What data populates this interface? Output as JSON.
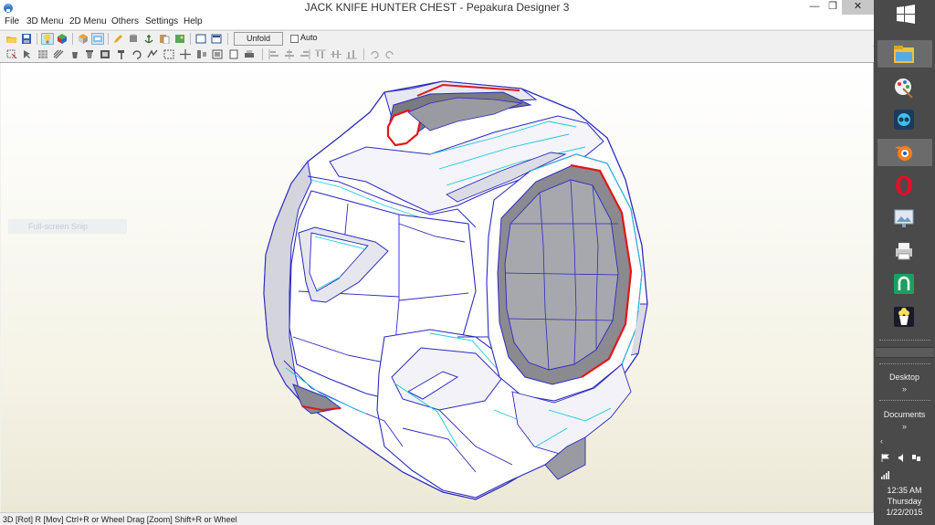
{
  "window": {
    "title": "JACK KNIFE HUNTER CHEST  - Pepakura Designer 3",
    "minimize_glyph": "—",
    "restore_glyph": "❐",
    "close_glyph": "✕"
  },
  "menubar": {
    "items": [
      "File",
      "3D Menu",
      "2D Menu",
      "Others",
      "Settings",
      "Help"
    ]
  },
  "toolbar": {
    "unfold_label": "Unfold",
    "auto_label": "Auto",
    "auto_checked": false
  },
  "viewport": {
    "overlay_label": "Full-screen Snip"
  },
  "statusbar": {
    "text": "3D [Rot] R [Mov] Ctrl+R or Wheel Drag [Zoom] Shift+R or Wheel"
  },
  "taskbar": {
    "pinned_icons": [
      "file-explorer-icon",
      "paint-icon",
      "steam-icon",
      "blender-icon",
      "opera-icon",
      "slideshow-icon",
      "printer-icon",
      "shield-app-icon",
      "popcorn-icon"
    ],
    "toolbars": [
      {
        "label": "Desktop",
        "chevron": "»"
      },
      {
        "label": "Documents",
        "chevron": "»"
      }
    ],
    "tray_chevron": "‹",
    "clock": {
      "time": "12:35 AM",
      "day": "Thursday",
      "date": "1/22/2015"
    }
  },
  "colors": {
    "accent_active": "#cde4f7",
    "mesh_edge": "#2b2bbf",
    "mesh_fold": "#20c8d8",
    "mesh_cut": "#e01818",
    "taskbar_bg": "#4a4a4a"
  }
}
